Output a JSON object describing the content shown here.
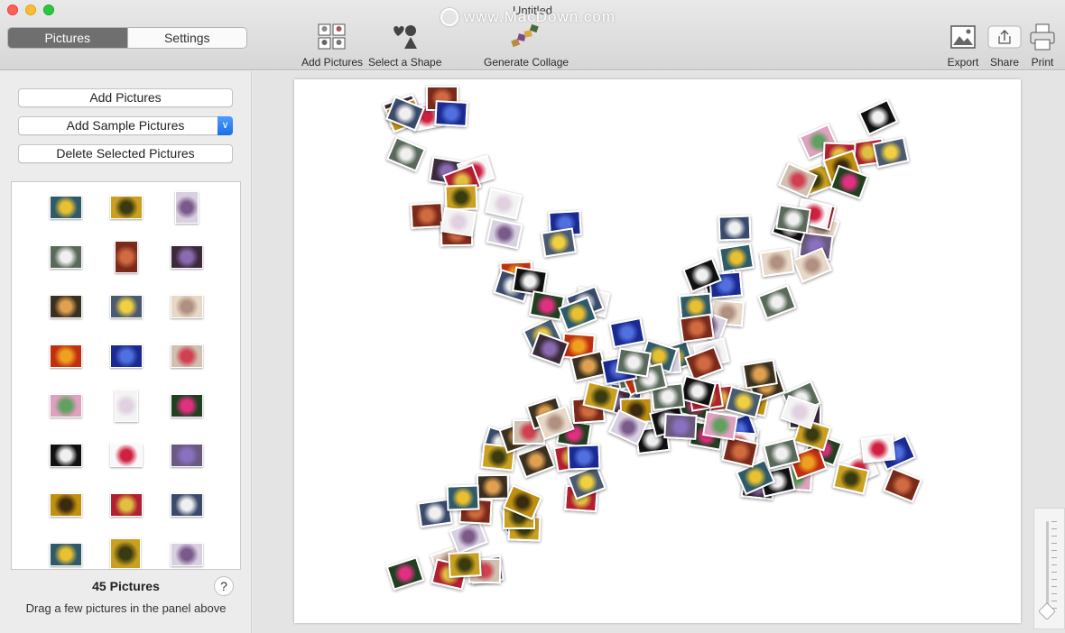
{
  "window": {
    "title": "Untitled",
    "watermark": "www.MacDown.com"
  },
  "toolbar": {
    "tabs": [
      {
        "label": "Pictures",
        "active": true
      },
      {
        "label": "Settings",
        "active": false
      }
    ],
    "add_pictures": "Add Pictures",
    "select_shape": "Select a Shape",
    "generate_collage": "Generate Collage",
    "export": "Export",
    "share": "Share",
    "print": "Print"
  },
  "sidebar": {
    "add_pictures_button": "Add Pictures",
    "add_sample_button": "Add Sample Pictures",
    "delete_button": "Delete Selected Pictures",
    "count": "45 Pictures",
    "help": "?",
    "hint": "Drag a few pictures in the panel above"
  },
  "colors": {
    "accent": "#1a6fe8",
    "segment_active": "#6f6f6f"
  },
  "zoom": {
    "level": 0.05
  }
}
